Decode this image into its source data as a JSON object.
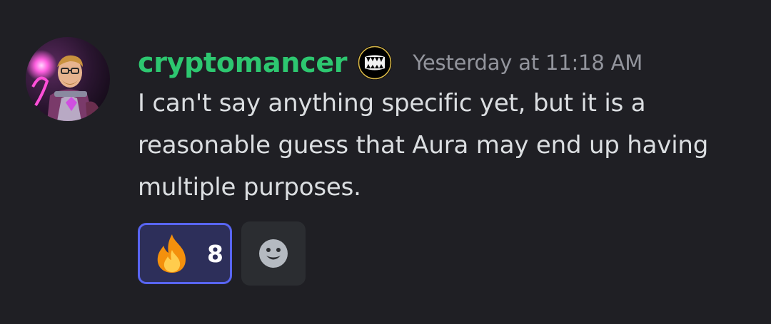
{
  "message": {
    "author": {
      "name": "cryptomancer",
      "name_color": "#2dc770",
      "avatar_icon": "wizard-avatar",
      "badge_icon": "fanged-mouth-badge"
    },
    "timestamp": "Yesterday at 11:18 AM",
    "content": "I can't say anything specific yet, but it is a reasonable guess that Aura may end up having multiple purposes.",
    "reactions": [
      {
        "emoji_icon": "fire-icon",
        "count": "8",
        "active": true
      }
    ],
    "add_reaction_icon": "smiley-face-icon"
  }
}
